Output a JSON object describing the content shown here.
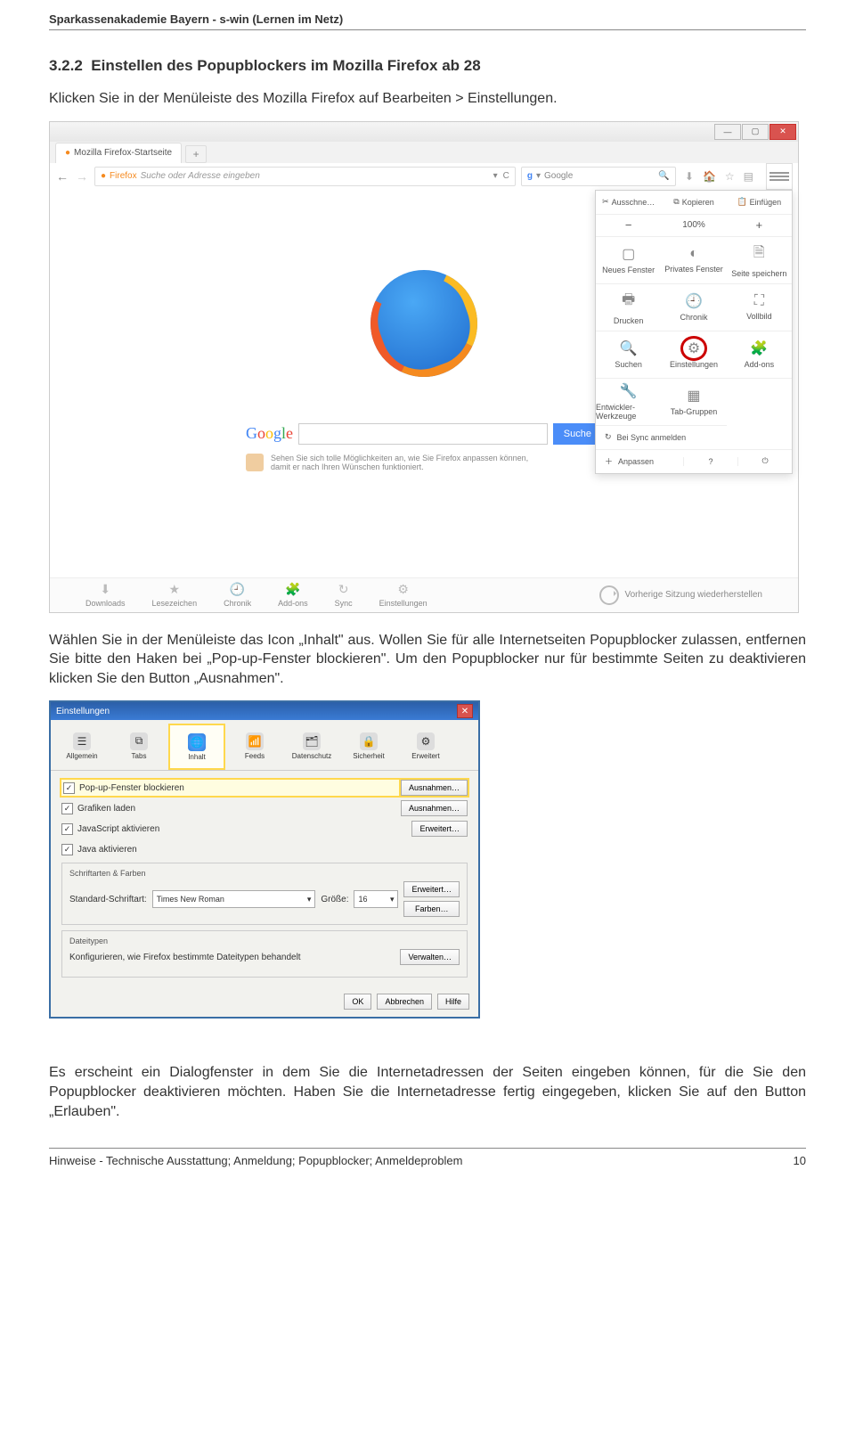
{
  "doc": {
    "header": "Sparkassenakademie Bayern - s-win (Lernen im Netz)",
    "section_no": "3.2.2",
    "section_title": "Einstellen des Popupblockers im Mozilla Firefox ab 28",
    "p1": "Klicken Sie in der Menüleiste des Mozilla Firefox auf Bearbeiten > Einstellungen.",
    "p2": "Wählen Sie in der Menüleiste das Icon „Inhalt\" aus. Wollen Sie für alle Internetseiten Popupblocker zulassen, entfernen Sie bitte den Haken bei „Pop-up-Fenster blockieren\". Um den Popupblocker nur für bestimmte Seiten zu deaktivieren klicken Sie den Button „Ausnahmen\".",
    "p3": "Es erscheint ein Dialogfenster in dem Sie die Internetadressen der Seiten eingeben können, für die Sie den Popupblocker deaktivieren möchten. Haben Sie die Internetadresse fertig eingegeben, klicken Sie auf den Button „Erlauben\".",
    "footer_left": "Hinweise - Technische Ausstattung; Anmeldung; Popupblocker; Anmeldeproblem",
    "footer_right": "10"
  },
  "firefox": {
    "tab_label": "Mozilla Firefox-Startseite",
    "url_placeholder": "Suche oder Adresse eingeben",
    "searchbox_text": "Google",
    "google_label": "Google",
    "search_btn": "Suche",
    "tip1": "Sehen Sie sich tolle Möglichkeiten an, wie Sie Firefox anpassen können,",
    "tip2": "damit er nach Ihren Wünschen funktioniert.",
    "bb": {
      "downloads": "Downloads",
      "lesezeichen": "Lesezeichen",
      "chronik": "Chronik",
      "addons": "Add-ons",
      "sync": "Sync",
      "einstellungen": "Einstellungen"
    },
    "restore": "Vorherige Sitzung wiederherstellen"
  },
  "menu": {
    "cut": "Ausschne…",
    "copy": "Kopieren",
    "paste": "Einfügen",
    "zoom_minus": "−",
    "zoom_val": "100%",
    "zoom_plus": "+",
    "grid": [
      {
        "icon": "▢",
        "label": "Neues Fenster"
      },
      {
        "icon": "◐",
        "label": "Privates Fenster"
      },
      {
        "icon": "🗎",
        "label": "Seite speichern"
      },
      {
        "icon": "🖶",
        "label": "Drucken"
      },
      {
        "icon": "🕘",
        "label": "Chronik"
      },
      {
        "icon": "⛶",
        "label": "Vollbild"
      },
      {
        "icon": "🔍",
        "label": "Suchen"
      },
      {
        "icon": "⚙",
        "label": "Einstellungen",
        "hl": true
      },
      {
        "icon": "🧩",
        "label": "Add-ons"
      },
      {
        "icon": "🔧",
        "label": "Entwickler-Werkzeuge"
      },
      {
        "icon": "▦",
        "label": "Tab-Gruppen"
      },
      {
        "icon": "",
        "label": ""
      }
    ],
    "sync": "Bei Sync anmelden",
    "custom": "Anpassen",
    "help": "?",
    "power": "⏻"
  },
  "settings": {
    "title": "Einstellungen",
    "tabs": [
      "Allgemein",
      "Tabs",
      "Inhalt",
      "Feeds",
      "Datenschutz",
      "Sicherheit",
      "Erweitert"
    ],
    "sel_tab": 2,
    "opts": [
      {
        "label": "Pop-up-Fenster blockieren",
        "btn": "Ausnahmen…",
        "hl": true
      },
      {
        "label": "Grafiken laden",
        "btn": "Ausnahmen…"
      },
      {
        "label": "JavaScript aktivieren",
        "btn": "Erweitert…"
      },
      {
        "label": "Java aktivieren"
      }
    ],
    "fonts_legend": "Schriftarten & Farben",
    "font_label": "Standard-Schriftart:",
    "font_name": "Times New Roman",
    "size_lbl": "Größe:",
    "size_val": "16",
    "btn_adv": "Erweitert…",
    "btn_colors": "Farben…",
    "types_legend": "Dateitypen",
    "types_text": "Konfigurieren, wie Firefox bestimmte Dateitypen behandelt",
    "btn_manage": "Verwalten…",
    "ok": "OK",
    "cancel": "Abbrechen",
    "help": "Hilfe"
  }
}
